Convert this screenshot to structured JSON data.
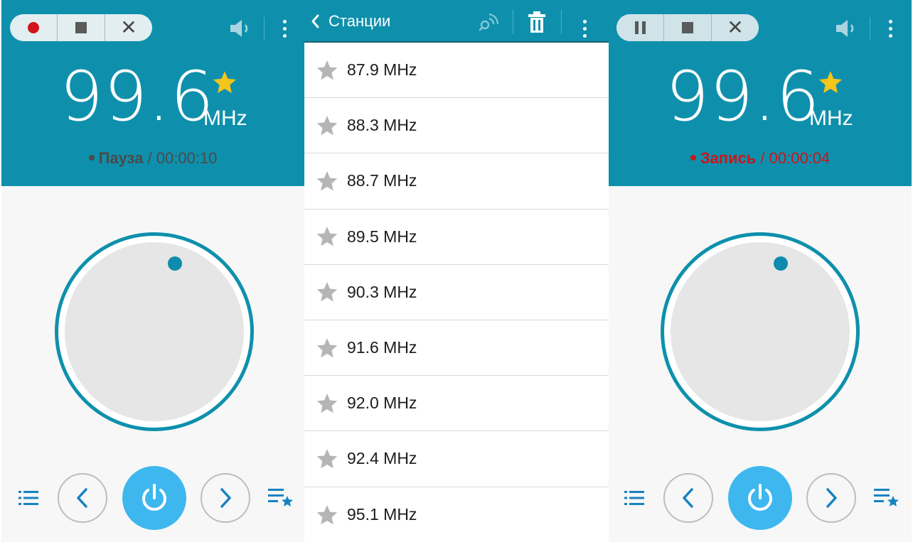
{
  "colors": {
    "accent": "#0e90ac",
    "star_gold": "#f6c51a",
    "record_red": "#c8161c",
    "power_blue": "#3eb7ef",
    "icon_blue": "#1582c2"
  },
  "left_screen": {
    "frequency": "99.6",
    "unit": "MHz",
    "status_label": "Пауза",
    "status_separator": " / ",
    "status_time": "00:00:10",
    "controls": [
      "record-icon",
      "stop-icon",
      "close-icon"
    ]
  },
  "station_list": {
    "title": "Станции",
    "stations": [
      {
        "label": "87.9 MHz"
      },
      {
        "label": "88.3 MHz"
      },
      {
        "label": "88.7 MHz"
      },
      {
        "label": "89.5 MHz"
      },
      {
        "label": "90.3 MHz"
      },
      {
        "label": "91.6 MHz"
      },
      {
        "label": "92.0 MHz"
      },
      {
        "label": "92.4 MHz"
      },
      {
        "label": "95.1 MHz"
      }
    ]
  },
  "right_screen": {
    "frequency": "99.6",
    "unit": "MHz",
    "status_label": "Запись",
    "status_separator": " / ",
    "status_time": "00:00:04",
    "controls": [
      "pause-icon",
      "stop-icon",
      "close-icon"
    ]
  }
}
